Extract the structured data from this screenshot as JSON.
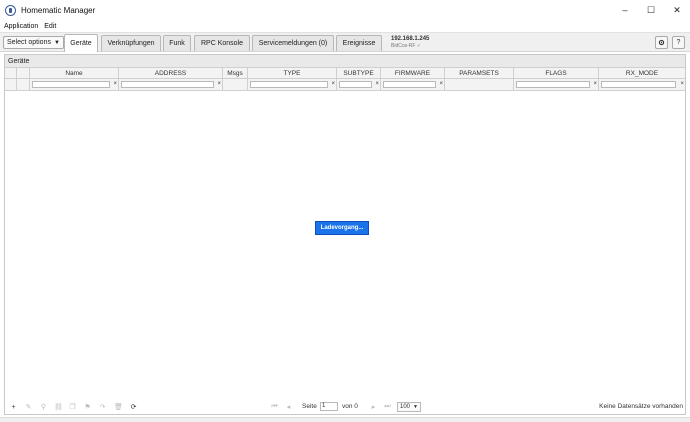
{
  "window": {
    "title": "Homematic Manager",
    "controls": {
      "minimize": "–",
      "maximize": "☐",
      "close": "✕"
    }
  },
  "menu": {
    "items": [
      "Application",
      "Edit"
    ]
  },
  "toolbar": {
    "select_options": "Select options",
    "tabs": [
      "Geräte",
      "Verknüpfungen",
      "Funk",
      "RPC Konsole",
      "Servicemeldungen (0)",
      "Ereignisse"
    ],
    "active_tab": "Geräte",
    "ip": "192.168.1.245",
    "ip_sub": "BidCos-RF ✓",
    "settings_icon": "gear-icon",
    "help_label": "?"
  },
  "panel": {
    "title": "Geräte",
    "columns": [
      "Name",
      "ADDRESS",
      "Msgs",
      "TYPE",
      "SUBTYPE",
      "FIRMWARE",
      "PARAMSETS",
      "FLAGS",
      "RX_MODE"
    ],
    "filter_clear": "×",
    "loading_text": "Ladevorgang..."
  },
  "pager": {
    "page_label": "Seite",
    "page_value": "1",
    "of_label": "von 0",
    "rows_per_page": "100",
    "records_text": "Keine Datensätze vorhanden"
  },
  "colors": {
    "accent": "#1a73e8",
    "toolbar_bg": "#f0f0f0"
  }
}
